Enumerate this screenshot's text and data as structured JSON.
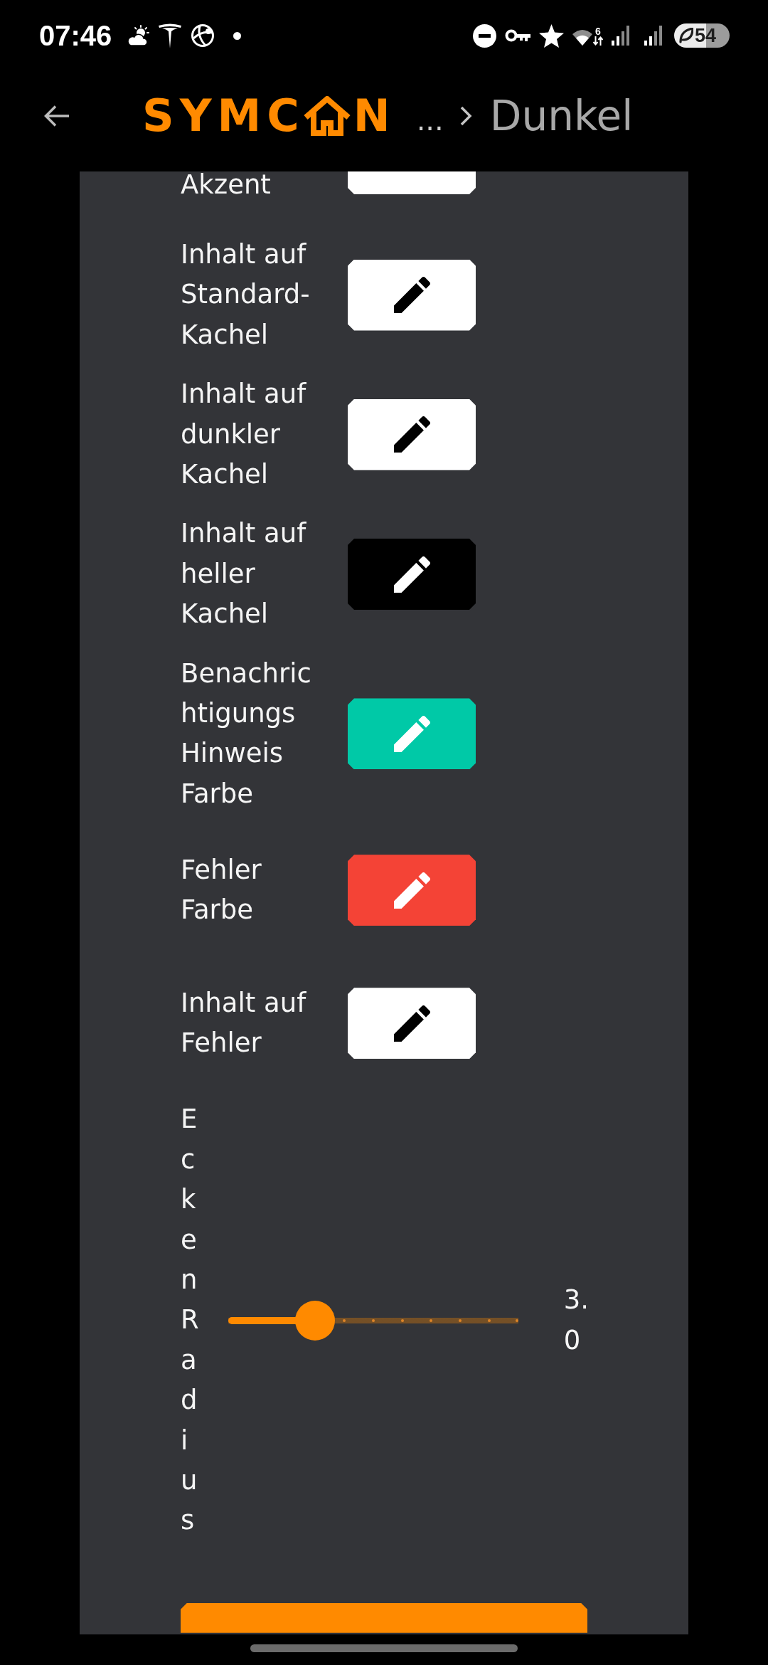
{
  "status_bar": {
    "time": "07:46",
    "wifi_label": "6",
    "battery": "54"
  },
  "header": {
    "logo": {
      "lead": "SYMC",
      "tail": "N"
    },
    "ellipsis": "...",
    "title": "Dunkel"
  },
  "color_rows": [
    {
      "label_lines": [
        "Akzent"
      ],
      "color": "#ffffff",
      "cut_off": true
    },
    {
      "label_lines": [
        "Inhalt auf",
        "Standard-",
        "Kachel"
      ],
      "color": "#ffffff",
      "cut_off": false
    },
    {
      "label_lines": [
        "Inhalt auf",
        "dunkler",
        "Kachel"
      ],
      "color": "#ffffff",
      "cut_off": false
    },
    {
      "label_lines": [
        "Inhalt auf",
        "heller",
        "Kachel"
      ],
      "color": "#000000",
      "cut_off": false
    },
    {
      "label_lines": [
        "Benachric",
        "htigungs",
        "Hinweis",
        "Farbe"
      ],
      "color": "#00c9a7",
      "cut_off": false
    },
    {
      "label_lines": [
        "Fehler",
        "Farbe"
      ],
      "color": "#f44336",
      "cut_off": false
    },
    {
      "label_lines": [
        "Inhalt auf",
        "Fehler"
      ],
      "color": "#ffffff",
      "cut_off": false
    }
  ],
  "corner_radius": {
    "label": "EckenRadius",
    "level": 0.3,
    "value": "3.0"
  },
  "footer_button": {
    "cut_off": true
  }
}
